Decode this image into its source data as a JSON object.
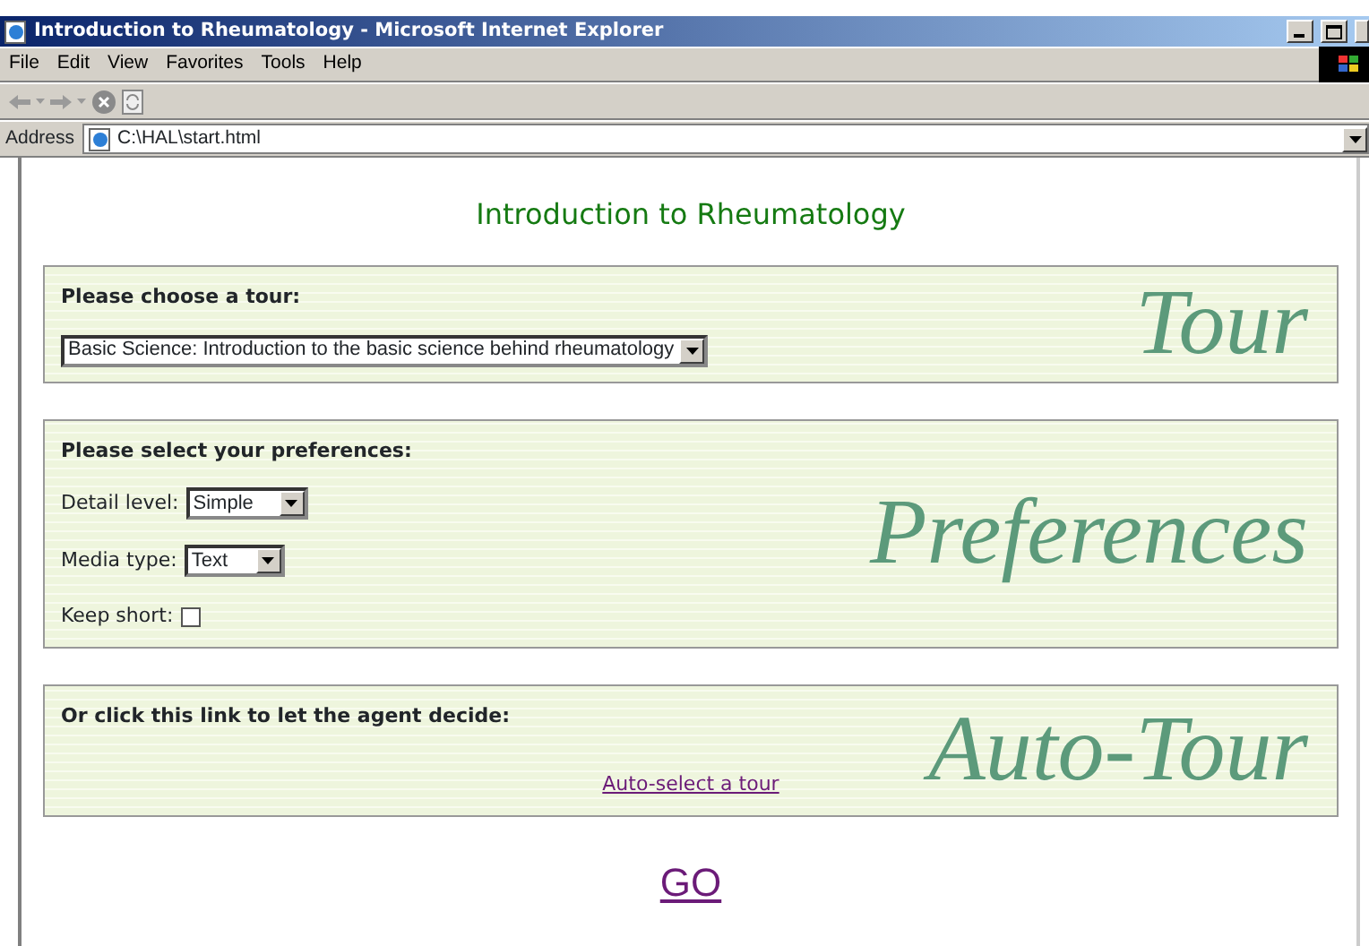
{
  "window": {
    "title": "Introduction to Rheumatology - Microsoft Internet Explorer"
  },
  "menu": [
    "File",
    "Edit",
    "View",
    "Favorites",
    "Tools",
    "Help"
  ],
  "address": {
    "label": "Address",
    "value": "C:\\HAL\\start.html"
  },
  "page": {
    "heading": "Introduction to Rheumatology",
    "sections": [
      {
        "prompt": "Please choose a tour:",
        "watermark": "Tour",
        "fields": [
          {
            "kind": "select",
            "value": "Basic Science: Introduction to the basic science behind rheumatology"
          }
        ]
      },
      {
        "prompt": "Please select your preferences:",
        "watermark": "Preferences",
        "fields": [
          {
            "kind": "select",
            "label": "Detail level:",
            "value": "Simple"
          },
          {
            "kind": "select",
            "label": "Media type:",
            "value": "Text"
          },
          {
            "kind": "checkbox",
            "label": "Keep short:",
            "checked": false
          }
        ]
      },
      {
        "prompt": "Or click this link to let the agent decide:",
        "watermark": "Auto-Tour",
        "fields": [
          {
            "kind": "link",
            "value": "Auto-select a tour"
          }
        ]
      }
    ],
    "go": "GO"
  }
}
